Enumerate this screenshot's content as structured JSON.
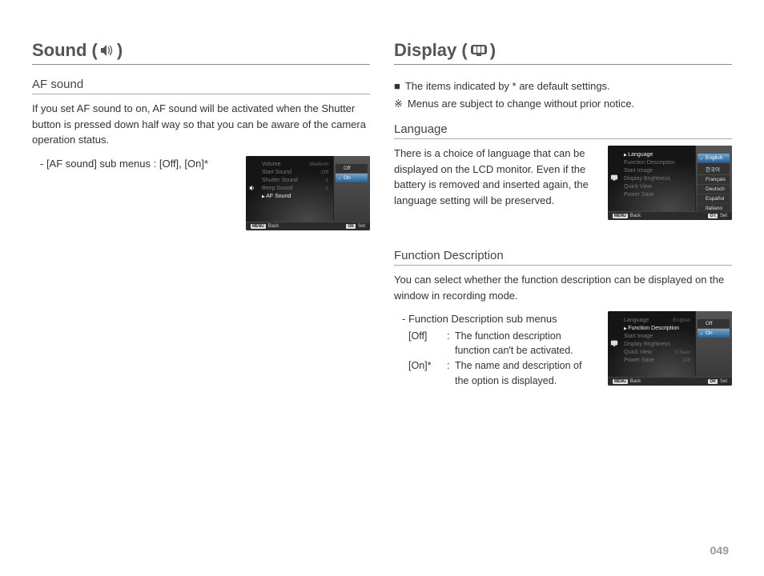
{
  "page_number": "049",
  "left": {
    "heading_pre": "Sound (",
    "heading_post": " )",
    "sub1": "AF sound",
    "para1": "If you set AF sound to on, AF sound will be activated when the Shutter button is pressed down half way so that you can be aware of the camera operation status.",
    "bullet1": "- [AF sound] sub menus : [Off], [On]*",
    "lcd1": {
      "rows": [
        {
          "label": "Volume",
          "value": ":Medium"
        },
        {
          "label": "Start Sound",
          "value": ":Off"
        },
        {
          "label": "Shutter Sound",
          "value": ":1"
        },
        {
          "label": "Beep Sound",
          "value": ":1"
        },
        {
          "label": "AF Sound",
          "value": ""
        }
      ],
      "activeIndex": 4,
      "options": [
        "Off",
        "On"
      ],
      "selectedOption": 1,
      "footer_back_btn": "MENU",
      "footer_back": "Back",
      "footer_set_btn": "OK",
      "footer_set": "Set"
    }
  },
  "right": {
    "heading_pre": "Display (",
    "heading_post": " )",
    "note1_marker": "■",
    "note1": "The items indicated by * are default settings.",
    "note2_marker": "※",
    "note2": "Menus are subject to change without prior notice.",
    "lang_head": "Language",
    "lang_para": "There is a choice of language that can be displayed on the LCD monitor. Even if the battery is removed and inserted again, the language setting will be preserved.",
    "lcd_lang": {
      "rows": [
        {
          "label": "Language",
          "value": ""
        },
        {
          "label": "Function Description",
          "value": ""
        },
        {
          "label": "Start Image",
          "value": ""
        },
        {
          "label": "Display Brightness",
          "value": ""
        },
        {
          "label": "Quick View",
          "value": ""
        },
        {
          "label": "Power Save",
          "value": ""
        }
      ],
      "activeIndex": 0,
      "options": [
        "English",
        "한국어",
        "Français",
        "Deutsch",
        "Español",
        "Italiano"
      ],
      "selectedOption": 0,
      "footer_back_btn": "MENU",
      "footer_back": "Back",
      "footer_set_btn": "OK",
      "footer_set": "Set"
    },
    "fd_head": "Function Description",
    "fd_para": "You can select whether the function description can be displayed on the window in recording mode.",
    "fd_sub_title": "- Function Description sub menus",
    "fd_defs": [
      {
        "key": "[Off]",
        "val": "The function description function can't be activated."
      },
      {
        "key": "[On]*",
        "val": "The name and description of the option is displayed."
      }
    ],
    "lcd_fd": {
      "rows": [
        {
          "label": "Language",
          "value": ":English"
        },
        {
          "label": "Function Description",
          "value": ""
        },
        {
          "label": "Start Image",
          "value": ""
        },
        {
          "label": "Display Brightness",
          "value": ""
        },
        {
          "label": "Quick View",
          "value": ":0.5sec"
        },
        {
          "label": "Power Save",
          "value": ":Off"
        }
      ],
      "activeIndex": 1,
      "options": [
        "Off",
        "On"
      ],
      "selectedOption": 1,
      "footer_back_btn": "MENU",
      "footer_back": "Back",
      "footer_set_btn": "OK",
      "footer_set": "Set"
    }
  }
}
